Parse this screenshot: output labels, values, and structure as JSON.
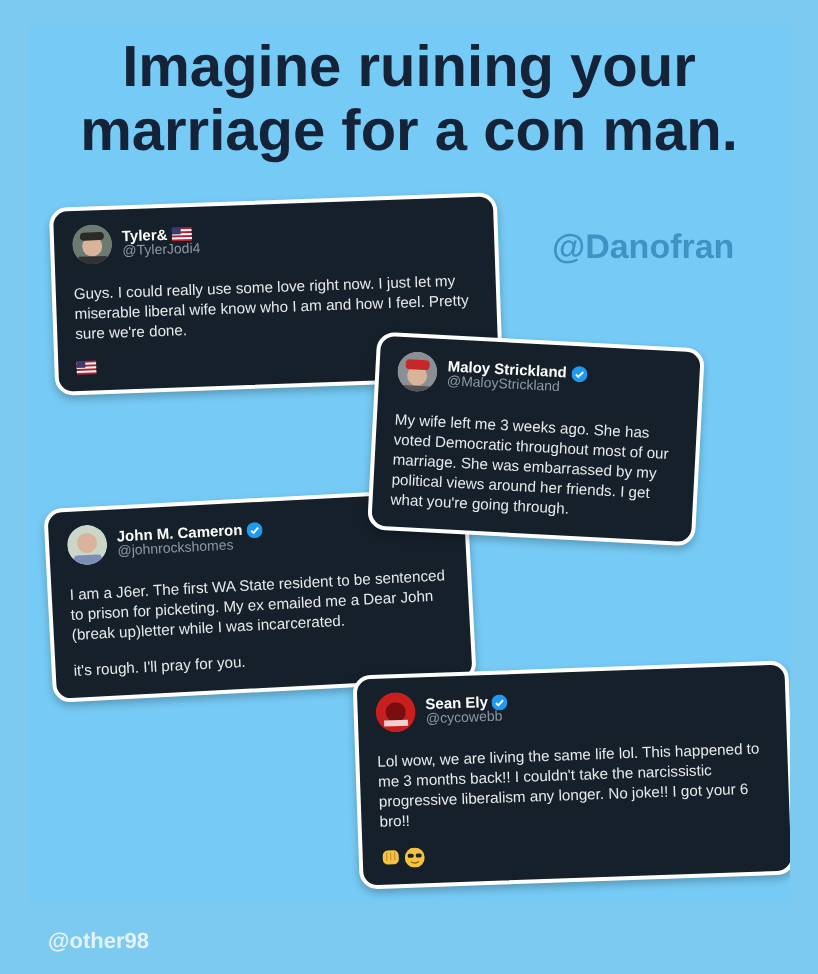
{
  "headline": "Imagine ruining your marriage for a con man.",
  "credit_overlay": "@Danofran",
  "tweets": [
    {
      "name": "Tyler&",
      "handle": "@TylerJodi4",
      "verified": false,
      "paragraphs": [
        "Guys. I could really use some love right now. I just let my miserable liberal wife know who I am and how I feel. Pretty sure we're done."
      ]
    },
    {
      "name": "Maloy Strickland",
      "handle": "@MaloyStrickland",
      "verified": true,
      "paragraphs": [
        "My wife left me 3 weeks ago.  She has voted Democratic throughout most of our marriage. She was embarrassed by my political views around her friends. I get what you're going through."
      ]
    },
    {
      "name": "John M. Cameron",
      "handle": "@johnrockshomes",
      "verified": true,
      "paragraphs": [
        "I am a J6er.  The first WA State resident to be sentenced to prison for picketing.   My ex emailed me a Dear John (break up)letter while I was incarcerated.",
        "it's rough.   I'll pray for you."
      ]
    },
    {
      "name": "Sean Ely",
      "handle": "@cycowebb",
      "verified": true,
      "paragraphs": [
        "Lol wow, we are living the same life lol. This happened to me 3 months back!! I couldn't take the narcissistic progressive liberalism any longer. No joke!! I got your 6 bro!!"
      ]
    }
  ],
  "footer_credit": "@other98"
}
